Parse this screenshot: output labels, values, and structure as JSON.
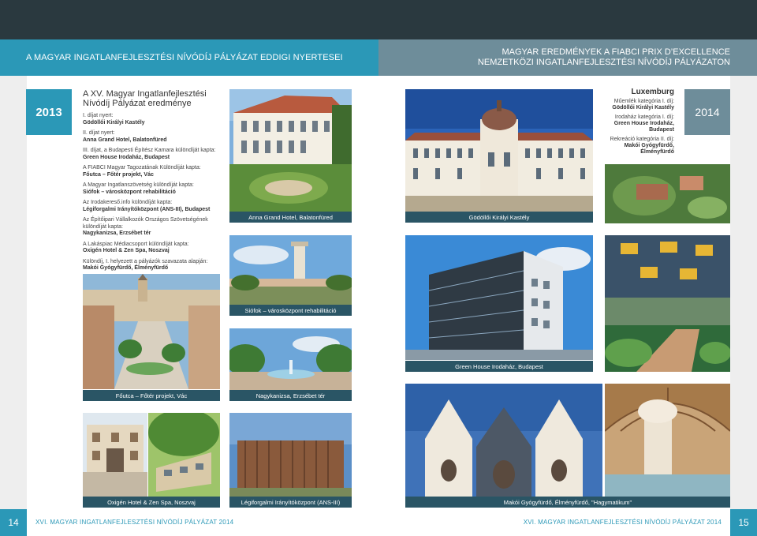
{
  "header": {
    "left_title": "A MAGYAR INGATLANFEJLESZTÉSI NÍVÓDÍJ PÁLYÁZAT EDDIGI NYERTESEI",
    "right_line1": "MAGYAR EREDMÉNYEK A FIABCI PRIX D’EXCELLENCE",
    "right_line2": "NEMZETKÖZI INGATLANFEJLESZTÉSI NÍVÓDÍJ PÁLYÁZATON"
  },
  "left_page": {
    "year": "2013",
    "title": "A XV. Magyar Ingatlanfejlesztési Nívódíj Pályázat eredménye",
    "awards": [
      {
        "label": "I. díjat nyert:",
        "winner": "Gödöllői Királyi Kastély"
      },
      {
        "label": "II. díjat nyert:",
        "winner": "Anna Grand Hotel, Balatonfüred"
      },
      {
        "label": "III. díjat, a Budapesti Építész Kamara különdíját kapta:",
        "winner": "Green House Irodaház, Budapest"
      },
      {
        "label": "A FIABCI Magyar Tagozatának Különdíját kapta:",
        "winner": "Főutca – Főtér projekt, Vác"
      },
      {
        "label": "A Magyar Ingatlanszövetség különdíját kapta:",
        "winner": "Siófok – városközpont rehabilitáció"
      },
      {
        "label": "Az Irodakereső.info különdíját kapta:",
        "winner": "Légiforgalmi Irányítóközpont (ANS-III), Budapest"
      },
      {
        "label": "Az Építőipari Vállalkozók Országos Szövetségének különdíját kapta:",
        "winner": "Nagykanizsa, Erzsébet tér"
      },
      {
        "label": "A Lakáspiac Médiacsoport különdíját kapta:",
        "winner": "Oxigén Hotel & Zen Spa, Noszvaj"
      },
      {
        "label": "Különdíj, I. helyezett a pályázók szavazata alapján:",
        "winner": "Makói Gyógyfürdő, Élményfürdő"
      }
    ]
  },
  "right_page": {
    "year": "2014",
    "location": "Luxemburg",
    "awards": [
      {
        "label": "Műemlék kategória I. díj:",
        "winner": "Gödöllői Királyi Kastély"
      },
      {
        "label": "Irodaház kategória I. díj:",
        "winner": "Green House Irodaház, Budapest"
      },
      {
        "label": "Rekreáció kategória II. díj:",
        "winner": "Makói Gyógyfürdő, Élményfürdő"
      }
    ]
  },
  "captions": {
    "anna": "Anna Grand Hotel, Balatonfüred",
    "godollo": "Gödöllői Királyi Kastély",
    "siofok": "Siófok – városközpont rehabilitáció",
    "greenhouse": "Green House Irodaház, Budapest",
    "fotutca": "Főutca – Főtér projekt, Vác",
    "nagykanizsa": "Nagykanizsa, Erzsébet tér",
    "oxigen": "Oxigén Hotel & Zen Spa, Noszvaj",
    "legiforgalmi": "Légiforgalmi Irányítóközpont (ANS-III)",
    "mako": "Makói Gyógyfürdő, Élményfürdő, \"Hagymatikum\""
  },
  "footer": {
    "left_page_num": "14",
    "right_page_num": "15",
    "left_text": "XVI. MAGYAR INGATLANFEJLESZTÉSI NÍVÓDÍJ PÁLYÁZAT 2014",
    "right_text": "XVI. MAGYAR INGATLANFEJLESZTÉSI NÍVÓDÍJ PÁLYÁZAT 2014"
  },
  "colors": {
    "accent_blue": "#2b98b7",
    "accent_gray_blue": "#6e8d9a",
    "top_bar": "#2a393f",
    "caption_bg": "#2a5565"
  }
}
